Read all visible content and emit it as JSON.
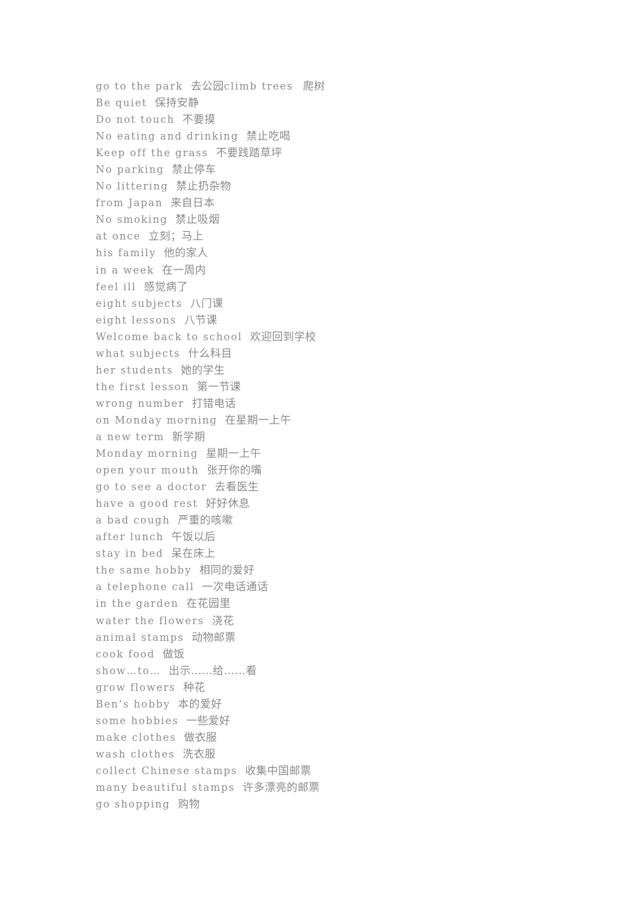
{
  "document": {
    "type": "scanned-vocabulary-list",
    "language_pair": "English-Chinese",
    "text_color": "#8b8b8b",
    "background_color": "#ffffff",
    "total_lines": 44
  },
  "lines": [
    {
      "en": "go to the park",
      "zh": "去公园",
      "en2": "climb trees",
      "zh2": "爬树"
    },
    {
      "en": "Be quiet",
      "zh": "保持安静"
    },
    {
      "en": "Do not touch",
      "zh": "不要摸"
    },
    {
      "en": "No eating and drinking",
      "zh": "禁止吃喝"
    },
    {
      "en": "Keep off the grass",
      "zh": "不要践踏草坪"
    },
    {
      "en": "No parking",
      "zh": "禁止停车"
    },
    {
      "en": "No littering",
      "zh": "禁止扔杂物"
    },
    {
      "en": "from Japan",
      "zh": "来自日本"
    },
    {
      "en": "No smoking",
      "zh": "禁止吸烟"
    },
    {
      "en": "at once",
      "zh": "立刻；马上"
    },
    {
      "en": "his family",
      "zh": "他的家人"
    },
    {
      "en": "in a week",
      "zh": "在一周内"
    },
    {
      "en": "feel ill",
      "zh": "感觉病了"
    },
    {
      "en": "eight subjects",
      "zh": "八门课"
    },
    {
      "en": "eight lessons",
      "zh": "八节课"
    },
    {
      "en": "Welcome back to school",
      "zh": "欢迎回到学校"
    },
    {
      "en": "what subjects",
      "zh": "什么科目"
    },
    {
      "en": "her students",
      "zh": "她的学生"
    },
    {
      "en": "the first lesson",
      "zh": "第一节课"
    },
    {
      "en": "wrong number",
      "zh": "打错电话"
    },
    {
      "en": "on Monday morning",
      "zh": "在星期一上午"
    },
    {
      "en": "a new term",
      "zh": "新学期"
    },
    {
      "en": "Monday morning",
      "zh": "星期一上午"
    },
    {
      "en": "open your mouth",
      "zh": "张开你的嘴"
    },
    {
      "en": "go to see a doctor",
      "zh": "去看医生"
    },
    {
      "en": "have a good rest",
      "zh": "好好休息"
    },
    {
      "en": "a bad cough",
      "zh": "严重的咳嗽"
    },
    {
      "en": "after lunch",
      "zh": "午饭以后"
    },
    {
      "en": "stay in bed",
      "zh": "呆在床上"
    },
    {
      "en": "the same hobby",
      "zh": "相同的爱好"
    },
    {
      "en": "a telephone call",
      "zh": "一次电话通话"
    },
    {
      "en": "in the garden",
      "zh": "在花园里"
    },
    {
      "en": "water the flowers",
      "zh": "浇花"
    },
    {
      "en": "animal stamps",
      "zh": "动物邮票"
    },
    {
      "en": "cook food",
      "zh": "做饭"
    },
    {
      "en": "show…to…",
      "zh": "出示……给……看"
    },
    {
      "en": "grow flowers",
      "zh": "种花"
    },
    {
      "en": "Ben’s hobby",
      "zh": "本的爱好"
    },
    {
      "en": "some hobbies",
      "zh": "一些爱好"
    },
    {
      "en": "make clothes",
      "zh": "做衣服"
    },
    {
      "en": "wash clothes",
      "zh": "洗衣服"
    },
    {
      "en": "collect Chinese stamps",
      "zh": "收集中国邮票"
    },
    {
      "en": "many beautiful stamps",
      "zh": "许多漂亮的邮票"
    },
    {
      "en": "go shopping",
      "zh": "购物"
    }
  ]
}
